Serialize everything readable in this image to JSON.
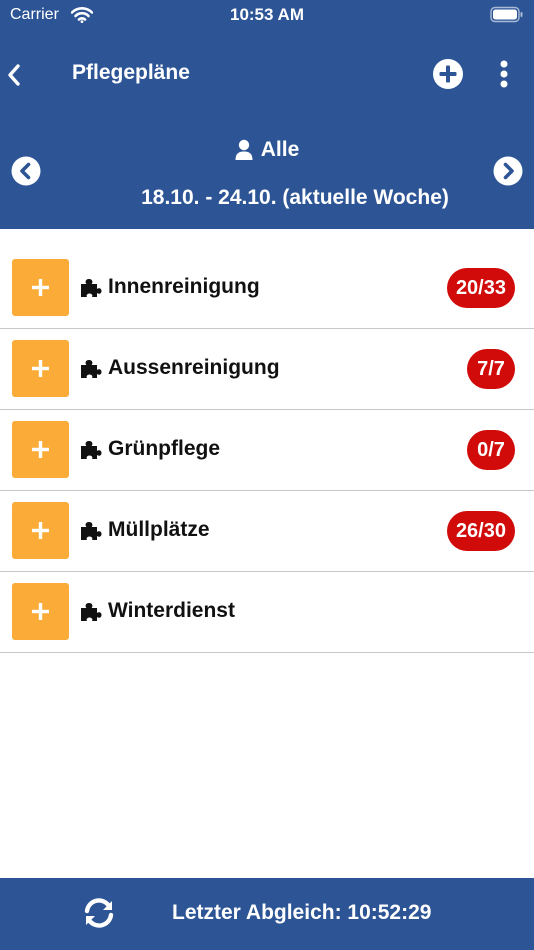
{
  "status_bar": {
    "carrier": "Carrier",
    "time": "10:53 AM"
  },
  "nav": {
    "title": "Pflegepläne"
  },
  "filter": {
    "person_label": "Alle",
    "week_range": "18.10. - 24.10. (aktuelle Woche)"
  },
  "items": [
    {
      "label": "Innenreinigung",
      "badge": "20/33"
    },
    {
      "label": "Aussenreinigung",
      "badge": "7/7"
    },
    {
      "label": "Grünpflege",
      "badge": "0/7"
    },
    {
      "label": "Müllplätze",
      "badge": "26/30"
    },
    {
      "label": "Winterdienst",
      "badge": ""
    }
  ],
  "footer": {
    "last_sync": "Letzter Abgleich: 10:52:29"
  },
  "colors": {
    "primary": "#2d5596",
    "accent": "#fbab38",
    "badge": "#d10a0a"
  },
  "icons": {
    "back": "chevron-left-icon",
    "add": "plus-circle-icon",
    "more": "more-vertical-icon",
    "person": "person-icon",
    "prev": "chevron-left-circle-icon",
    "next": "chevron-right-circle-icon",
    "item": "puzzle-icon",
    "item_add": "plus-icon",
    "sync": "sync-icon"
  }
}
